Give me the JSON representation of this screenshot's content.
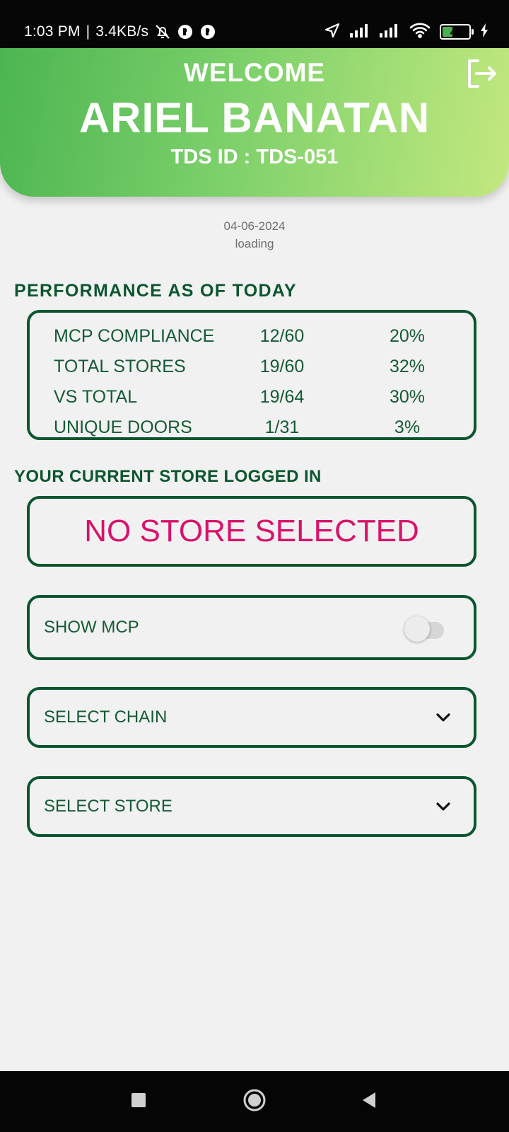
{
  "status_bar": {
    "time": "1:03 PM",
    "separator": "|",
    "speed": "3.4KB/s",
    "battery": "40",
    "icons": [
      "bell-off-icon",
      "app-notification-icon",
      "app-notification-icon",
      "location-arrow-icon",
      "signal-icon",
      "signal-icon",
      "wifi-icon",
      "battery-icon",
      "charging-icon"
    ]
  },
  "header": {
    "welcome": "WELCOME",
    "name": "ARIEL BANATAN",
    "tds_id": "TDS ID : TDS-051",
    "logout_icon": "logout-icon"
  },
  "date": "04-06-2024",
  "loading": "loading",
  "performance": {
    "title": "PERFORMANCE AS OF TODAY",
    "rows": [
      {
        "label": "MCP COMPLIANCE",
        "count": "12/60",
        "percent": "20%"
      },
      {
        "label": "TOTAL STORES",
        "count": "19/60",
        "percent": "32%"
      },
      {
        "label": "VS TOTAL",
        "count": "19/64",
        "percent": "30%"
      },
      {
        "label": "UNIQUE DOORS",
        "count": "1/31",
        "percent": "3%"
      }
    ]
  },
  "current_store": {
    "title": "YOUR CURRENT STORE LOGGED IN",
    "value": "NO STORE SELECTED"
  },
  "show_mcp": {
    "label": "SHOW MCP",
    "enabled": false
  },
  "select_chain": {
    "placeholder": "SELECT CHAIN"
  },
  "select_store": {
    "placeholder": "SELECT STORE"
  },
  "colors": {
    "primary": "#0c5530",
    "accent_pink": "#d8126b",
    "header_start": "#4cb551",
    "header_end": "#c3e87f"
  }
}
